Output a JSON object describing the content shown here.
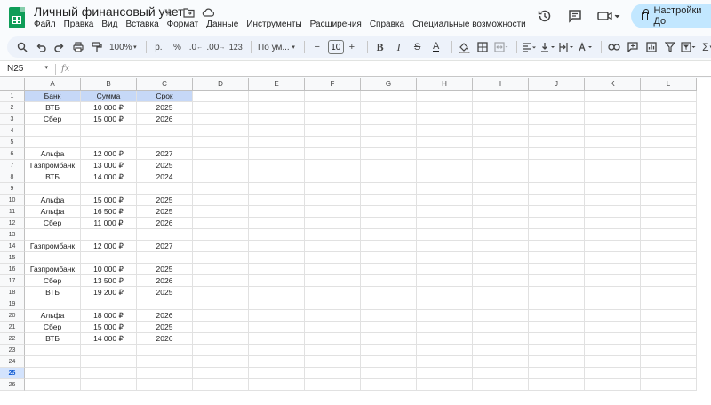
{
  "app": {
    "title": "Личный финансовый учет",
    "menu": [
      "Файл",
      "Правка",
      "Вид",
      "Вставка",
      "Формат",
      "Данные",
      "Инструменты",
      "Расширения",
      "Справка",
      "Специальные возможности"
    ],
    "share_label": "Настройки До",
    "accent": "#c2e7ff",
    "brand": "#0f9d58"
  },
  "toolbar": {
    "zoom": "100%",
    "currency": "р.",
    "percent": "%",
    "dec_decrease": ".0",
    "dec_increase": ".00",
    "number_format": "123",
    "font": "По ум...",
    "font_size": "10"
  },
  "formula": {
    "cell_ref": "N25",
    "fx": "fx",
    "value": ""
  },
  "sheet": {
    "columns": [
      "A",
      "B",
      "C",
      "D",
      "E",
      "F",
      "G",
      "H",
      "I",
      "J",
      "K",
      "L"
    ],
    "active_row": 25,
    "header_color": "#c6d8f7",
    "rows": [
      [
        "Банк",
        "Сумма",
        "Срок"
      ],
      [
        "ВТБ",
        "10 000 ₽",
        "2025"
      ],
      [
        "Сбер",
        "15 000 ₽",
        "2026"
      ],
      [
        "",
        "",
        ""
      ],
      [
        "",
        "",
        ""
      ],
      [
        "Альфа",
        "12 000 ₽",
        "2027"
      ],
      [
        "Газпромбанк",
        "13 000 ₽",
        "2025"
      ],
      [
        "ВТБ",
        "14 000 ₽",
        "2024"
      ],
      [
        "",
        "",
        ""
      ],
      [
        "Альфа",
        "15 000 ₽",
        "2025"
      ],
      [
        "Альфа",
        "16 500 ₽",
        "2025"
      ],
      [
        "Сбер",
        "11 000 ₽",
        "2026"
      ],
      [
        "",
        "",
        ""
      ],
      [
        "Газпромбанк",
        "12 000 ₽",
        "2027"
      ],
      [
        "",
        "",
        ""
      ],
      [
        "Газпромбанк",
        "10 000 ₽",
        "2025"
      ],
      [
        "Сбер",
        "13 500 ₽",
        "2026"
      ],
      [
        "ВТБ",
        "19 200 ₽",
        "2025"
      ],
      [
        "",
        "",
        ""
      ],
      [
        "Альфа",
        "18 000 ₽",
        "2026"
      ],
      [
        "Сбер",
        "15 000 ₽",
        "2025"
      ],
      [
        "ВТБ",
        "14 000 ₽",
        "2026"
      ],
      [
        "",
        "",
        ""
      ],
      [
        "",
        "",
        ""
      ],
      [
        "",
        "",
        ""
      ],
      [
        "",
        "",
        ""
      ]
    ]
  }
}
